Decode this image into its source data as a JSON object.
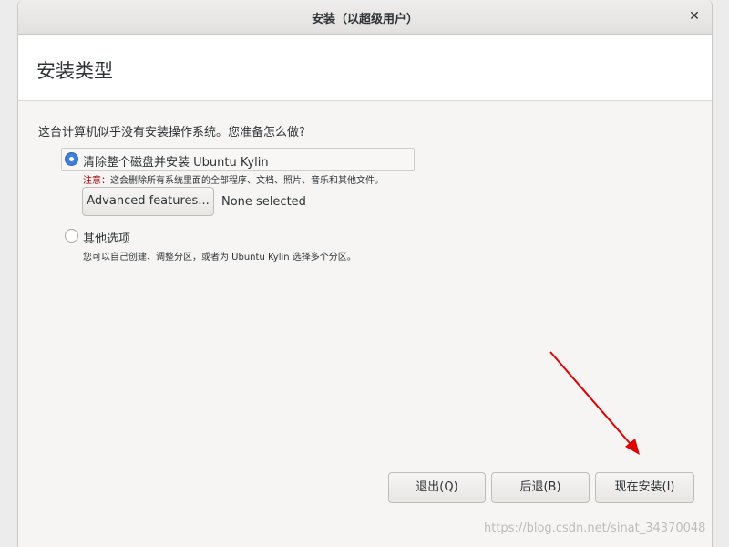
{
  "window": {
    "title": "安装（以超级用户）",
    "close_glyph": "✕"
  },
  "page": {
    "title": "安装类型",
    "question": "这台计算机似乎没有安装操作系统。您准备怎么做?"
  },
  "options": [
    {
      "label": "清除整个磁盘并安装 Ubuntu Kylin",
      "selected": true,
      "note_prefix": "注意：",
      "note_text": "这会删除所有系统里面的全部程序、文档、照片、音乐和其他文件。",
      "advanced_button": "Advanced features...",
      "advanced_status": "None selected"
    },
    {
      "label": "其他选项",
      "selected": false,
      "description": "您可以自己创建、调整分区，或者为 Ubuntu Kylin 选择多个分区。"
    }
  ],
  "buttons": {
    "quit": "退出(Q)",
    "back": "后退(B)",
    "install": "现在安装(I)"
  },
  "annotation": {
    "arrow_color": "#e00000"
  },
  "watermark": "https://blog.csdn.net/sinat_34370048",
  "colors": {
    "accent": "#3d7fd9",
    "warning": "#a40000"
  }
}
